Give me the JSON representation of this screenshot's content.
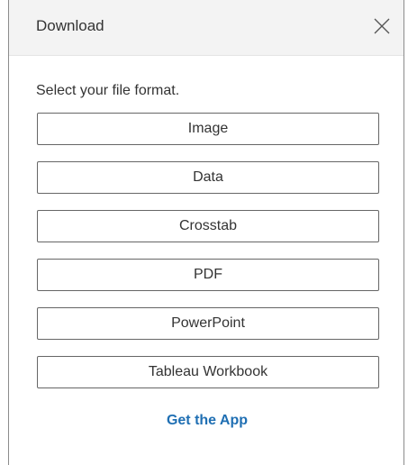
{
  "dialog": {
    "title": "Download",
    "prompt": "Select your file format.",
    "options": [
      {
        "label": "Image"
      },
      {
        "label": "Data"
      },
      {
        "label": "Crosstab"
      },
      {
        "label": "PDF"
      },
      {
        "label": "PowerPoint"
      },
      {
        "label": "Tableau Workbook"
      }
    ],
    "get_app_label": "Get the App",
    "close_icon": "close-icon"
  },
  "colors": {
    "header_bg": "#f3f3f3",
    "link": "#1f6fb3",
    "text": "#333333",
    "button_border": "#666666"
  }
}
